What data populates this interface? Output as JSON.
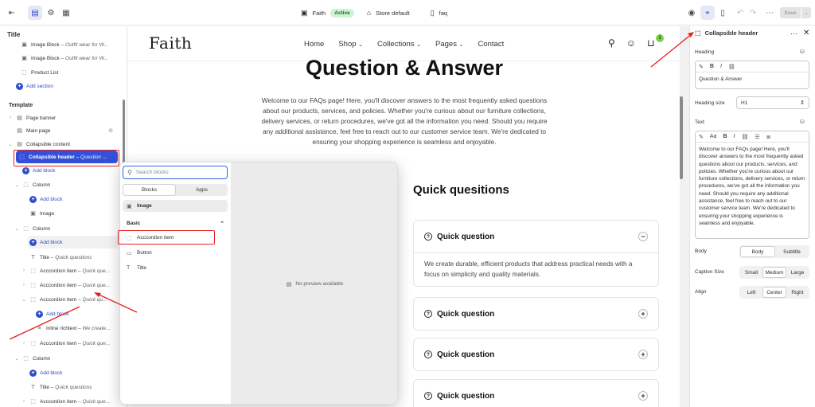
{
  "topbar": {
    "theme_name": "Faith",
    "theme_status": "Active",
    "store": "Store default",
    "page": "faq",
    "save_label": "Save"
  },
  "left_panel": {
    "title": "Title",
    "items": [
      {
        "label": "Image Block",
        "sub": "– Outfit wear for W..."
      },
      {
        "label": "Image Block",
        "sub": "– Outfit wear for W..."
      },
      {
        "label": "Product List",
        "sub": ""
      }
    ],
    "add_section": "Add section",
    "template_label": "Template",
    "page_banner": "Page banner",
    "main_page": "Main page",
    "collapsible_content": "Collapsible content",
    "collapsible_header": "Collapsible header",
    "collapsible_header_sub": "– Question ...",
    "add_block": "Add block",
    "column": "Column",
    "image": "Image",
    "title_sub": "– Quick questions",
    "accordion": "Acccordion item",
    "accordion_sub": "– Quick que...",
    "accordion_sub2": "– Quick qu...",
    "inline_richtext": "Inline richtext",
    "inline_sub": "– We create..."
  },
  "site": {
    "logo": "Faith",
    "nav": [
      "Home",
      "Shop",
      "Collections",
      "Pages",
      "Contact"
    ],
    "cart_count": "1",
    "hero_title": "Question & Answer",
    "hero_text": "Welcome to our FAQs page! Here, you'll discover answers to the most frequently asked questions about our products, services, and policies. Whether you're curious about our furniture collections, delivery services, or return procedures, we've got all the information you need. Should you require any additional assistance, feel free to reach out to our customer service team. We're dedicated to ensuring your shopping experience is seamless and enjoyable.",
    "quick_title": "Quick quesitions",
    "question_label": "Quick question",
    "answer": "We create durable, efficient products that address practical needs with a focus on simplicity and quality materials."
  },
  "picker": {
    "search_placeholder": "Search blocks",
    "tab_blocks": "Blocks",
    "tab_apps": "Apps",
    "image_item": "Image",
    "basic_label": "Basic",
    "items": [
      "Acccordion item",
      "Button",
      "Title"
    ],
    "no_preview": "No preview available"
  },
  "right_panel": {
    "title": "Collapsible header",
    "heading_label": "Heading",
    "heading_value": "Question & Answer",
    "heading_size_label": "Heading size",
    "heading_size_value": "H1",
    "text_label": "Text",
    "text_style": "Aa",
    "text_value": "Welcome to our FAQs page! Here, you'll discover answers to the most frequently asked questions about our products, services, and policies. Whether you're curious about our furniture collections, delivery services, or return procedures, we've got all the information you need. Should you require any additional assistance, feel free to reach out to our customer service team. We're dedicated to ensuring your shopping experience is seamless and enjoyable.",
    "body_label": "Body",
    "body_options": [
      "Body",
      "Subtitle"
    ],
    "caption_label": "Caption Size",
    "caption_options": [
      "Small",
      "Medium",
      "Large"
    ],
    "align_label": "Align",
    "align_options": [
      "Left",
      "Center",
      "Right"
    ]
  }
}
